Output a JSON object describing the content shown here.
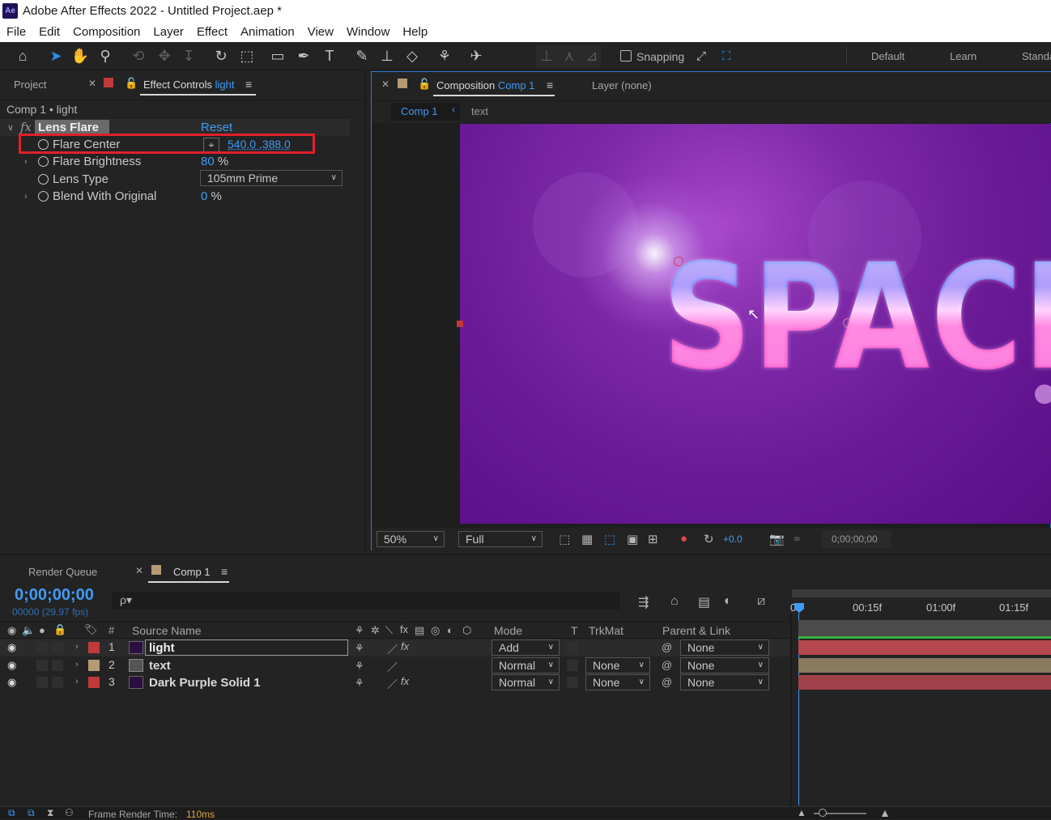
{
  "window": {
    "app_logo": "Ae",
    "title": "Adobe After Effects 2022 - Untitled Project.aep *"
  },
  "menu": [
    "File",
    "Edit",
    "Composition",
    "Layer",
    "Effect",
    "Animation",
    "View",
    "Window",
    "Help"
  ],
  "toolbar": {
    "snapping_label": "Snapping",
    "workspaces": [
      "Default",
      "Learn",
      "Standa"
    ]
  },
  "left_panel": {
    "tab_project": "Project",
    "tab_effect_controls": "Effect Controls",
    "tab_effect_controls_layer": "light",
    "breadcrumb": "Comp 1 • light",
    "effect": {
      "fx_label": "fx",
      "name": "Lens Flare",
      "reset_label": "Reset",
      "properties": [
        {
          "name": "Flare Center",
          "value": "540.0 ,388.0"
        },
        {
          "name": "Flare Brightness",
          "value": "80",
          "unit": "%"
        },
        {
          "name": "Lens Type",
          "value": "105mm Prime"
        },
        {
          "name": "Blend With Original",
          "value": "0",
          "unit": "%"
        }
      ]
    }
  },
  "comp_panel": {
    "tab_label": "Composition",
    "tab_comp_name": "Comp 1",
    "layer_tab": "Layer (none)",
    "breadcrumb_active": "Comp 1",
    "breadcrumb_next": "text",
    "canvas_text": "SPACE",
    "footer": {
      "zoom": "50%",
      "resolution": "Full",
      "exposure": "+0.0",
      "timecode": "0;00;00;00"
    }
  },
  "timeline": {
    "tab_render_queue": "Render Queue",
    "tab_comp": "Comp 1",
    "current_time": "0;00;00;00",
    "frame_info": "00000 (29.97 fps)",
    "search_icon_label": "ρ▾",
    "columns": {
      "hash": "#",
      "source_name": "Source Name",
      "mode": "Mode",
      "t": "T",
      "trkmat": "TrkMat",
      "parent": "Parent & Link"
    },
    "ruler_labels": [
      "0f",
      "00:15f",
      "01:00f",
      "01:15f"
    ],
    "layers": [
      {
        "num": "1",
        "name": "light",
        "mode": "Add",
        "trkmat": "",
        "parent": "None",
        "label_color": "#c03a3a",
        "bar_color": "#b5474f",
        "has_fx": true
      },
      {
        "num": "2",
        "name": "text",
        "mode": "Normal",
        "trkmat": "None",
        "parent": "None",
        "label_color": "#b59a74",
        "bar_color": "#8a7a5f",
        "has_fx": false
      },
      {
        "num": "3",
        "name": "Dark Purple Solid 1",
        "mode": "Normal",
        "trkmat": "None",
        "parent": "None",
        "label_color": "#c03a3a",
        "bar_color": "#a1424a",
        "has_fx": true
      }
    ]
  },
  "status_bar": {
    "render_label": "Frame Render Time:",
    "render_value": "110ms"
  },
  "colors": {
    "accent_blue": "#3f9bf5",
    "highlight_red": "#e0202a"
  }
}
